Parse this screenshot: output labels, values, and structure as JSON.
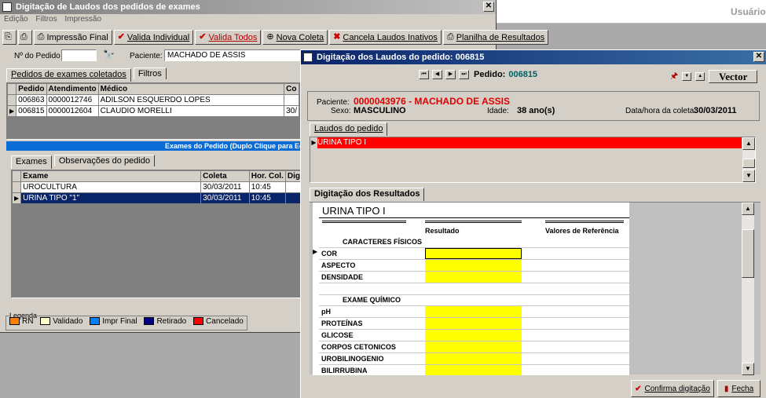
{
  "top_right_user": "Usuário",
  "main_window": {
    "title": "Digitação de Laudos dos pedidos de exames",
    "menu": [
      "Edição",
      "Filtros",
      "Impressão"
    ],
    "toolbar": {
      "impressao_final": "Impressão Final",
      "valida_individual": "Valida Individual",
      "valida_todos": "Valida Todos",
      "nova_coleta": "Nova Coleta",
      "cancela_laudos": "Cancela Laudos Inativos",
      "planilha": "Planilha de Resultados"
    },
    "pedido_label": "Nº do Pedido",
    "pedido_value": "",
    "paciente_label": "Paciente:",
    "paciente_value": "MACHADO DE ASSIS",
    "tabs": [
      "Pedidos de exames coletados",
      "Filtros"
    ],
    "pedidos_headers": [
      "Pedido",
      "Atendimento",
      "Médico",
      "Co"
    ],
    "pedidos_rows": [
      {
        "pedido": "006863",
        "atendimento": "0000012746",
        "medico": "ADILSON ESQUERDO LOPES",
        "co": ""
      },
      {
        "pedido": "006815",
        "atendimento": "0000012604",
        "medico": "CLAUDIO MORELLI",
        "co": "30/"
      }
    ],
    "exames_banner": "Exames do Pedido (Duplo Clique para Edi",
    "exam_tabs": [
      "Exames",
      "Observações do pedido"
    ],
    "exames_headers": [
      "Exame",
      "Coleta",
      "Hor. Col.",
      "Dig"
    ],
    "exames_rows": [
      {
        "exame": "UROCULTURA",
        "coleta": "30/03/2011",
        "hora": "10:45"
      },
      {
        "exame": "URINA TIPO \"1\"",
        "coleta": "30/03/2011",
        "hora": "10:45"
      }
    ],
    "legend_title": "Legenda",
    "legend": [
      {
        "label": "RN",
        "color": "#ff8000"
      },
      {
        "label": "Validado",
        "color": "#ffffcc"
      },
      {
        "label": "Impr Final",
        "color": "#0080ff"
      },
      {
        "label": "Retirado",
        "color": "#000080"
      },
      {
        "label": "Cancelado",
        "color": "#ff0000"
      }
    ]
  },
  "dialog": {
    "title": "Digitação dos Laudos do pedido: 006815",
    "pedido_label": "Pedido:",
    "pedido_value": "006815",
    "logo": "Vector",
    "paciente_label": "Paciente:",
    "paciente_value": "0000043976 - MACHADO DE ASSIS",
    "sexo_label": "Sexo:",
    "sexo_value": "MASCULINO",
    "idade_label": "Idade:",
    "idade_value": "38 ano(s)",
    "coleta_label": "Data/hora da coleta:",
    "coleta_value": "30/03/2011",
    "laudos_tab": "Laudos do pedido",
    "laudo_item": "URINA TIPO I",
    "resultados_tab": "Digitação dos Resultados",
    "form_title": "URINA TIPO I",
    "col_resultado": "Resultado",
    "col_referencia": "Valores de Referência",
    "section1": "CARACTERES FÍSICOS",
    "section2": "EXAME QUÍMICO",
    "fields1": [
      "COR",
      "ASPECTO",
      "DENSIDADE"
    ],
    "fields2": [
      "pH",
      "PROTEÍNAS",
      "GLICOSE",
      "CORPOS CETONICOS",
      "UROBILINOGENIO",
      "BILIRRUBINA"
    ],
    "confirma": "Confirma digitação",
    "fecha": "Fecha"
  }
}
